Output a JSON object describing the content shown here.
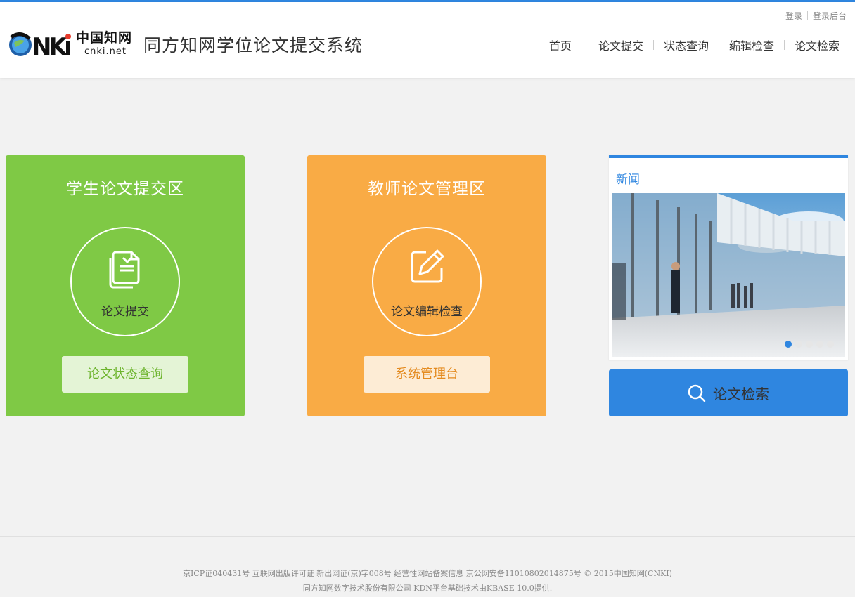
{
  "header": {
    "top_links": [
      "登录",
      "登录后台"
    ],
    "logo_chinese": "中国知网",
    "logo_domain": "cnki.net",
    "site_title": "同方知网学位论文提交系统",
    "nav": [
      "首页",
      "论文提交",
      "状态查询",
      "编辑检查",
      "论文检索"
    ]
  },
  "student_panel": {
    "title": "学生论文提交区",
    "circle_label": "论文提交",
    "button_label": "论文状态查询"
  },
  "teacher_panel": {
    "title": "教师论文管理区",
    "circle_label": "论文编辑检查",
    "button_label": "系统管理台"
  },
  "news": {
    "title": "新闻",
    "slide_count": 5,
    "active_slide": 1
  },
  "search": {
    "label": "论文检索"
  },
  "footer": {
    "line1": "京ICP证040431号 互联网出版许可证 新出网证(京)字008号 经营性网站备案信息 京公网安备11010802014875号 © 2015中国知网(CNKI)",
    "line2": "同方知网数字技术股份有限公司 KDN平台基础技术由KBASE 10.0提供."
  },
  "colors": {
    "accent_blue": "#2f86e0",
    "student_green": "#7fc945",
    "teacher_orange": "#f9ab45"
  }
}
